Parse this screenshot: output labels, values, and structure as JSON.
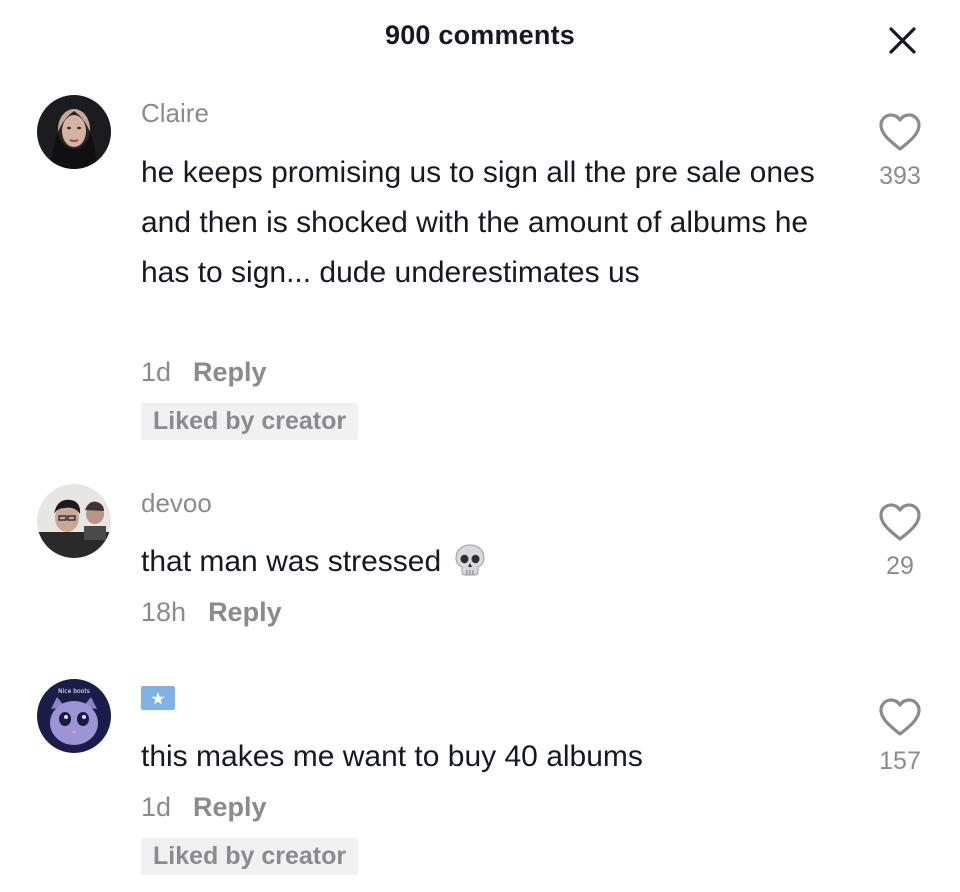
{
  "header": {
    "title": "900 comments",
    "close_icon": "close-icon"
  },
  "comments": [
    {
      "username": "Claire",
      "text": "he keeps promising us to sign all the pre sale ones and then is shocked with the amount of albums he has to sign... dude underestimates us",
      "time": "1d",
      "reply_label": "Reply",
      "badge": "Liked by creator",
      "likes": "393",
      "avatar_icon": "avatar-dark-hair"
    },
    {
      "username": "devoo",
      "text": "that man was stressed",
      "emoji_icon": "skull-icon",
      "time": "18h",
      "reply_label": "Reply",
      "likes": "29",
      "avatar_icon": "avatar-two-people"
    },
    {
      "username_icon": "flag-icon",
      "text": "this makes me want to buy 40 albums",
      "time": "1d",
      "reply_label": "Reply",
      "badge": "Liked by creator",
      "likes": "157",
      "avatar_text": "Nice boots",
      "avatar_icon": "avatar-cat"
    }
  ],
  "colors": {
    "text_primary": "#161823",
    "text_secondary": "#8a8b91",
    "badge_bg": "#f1f1f2",
    "flag_blue": "#7fb2e5"
  }
}
